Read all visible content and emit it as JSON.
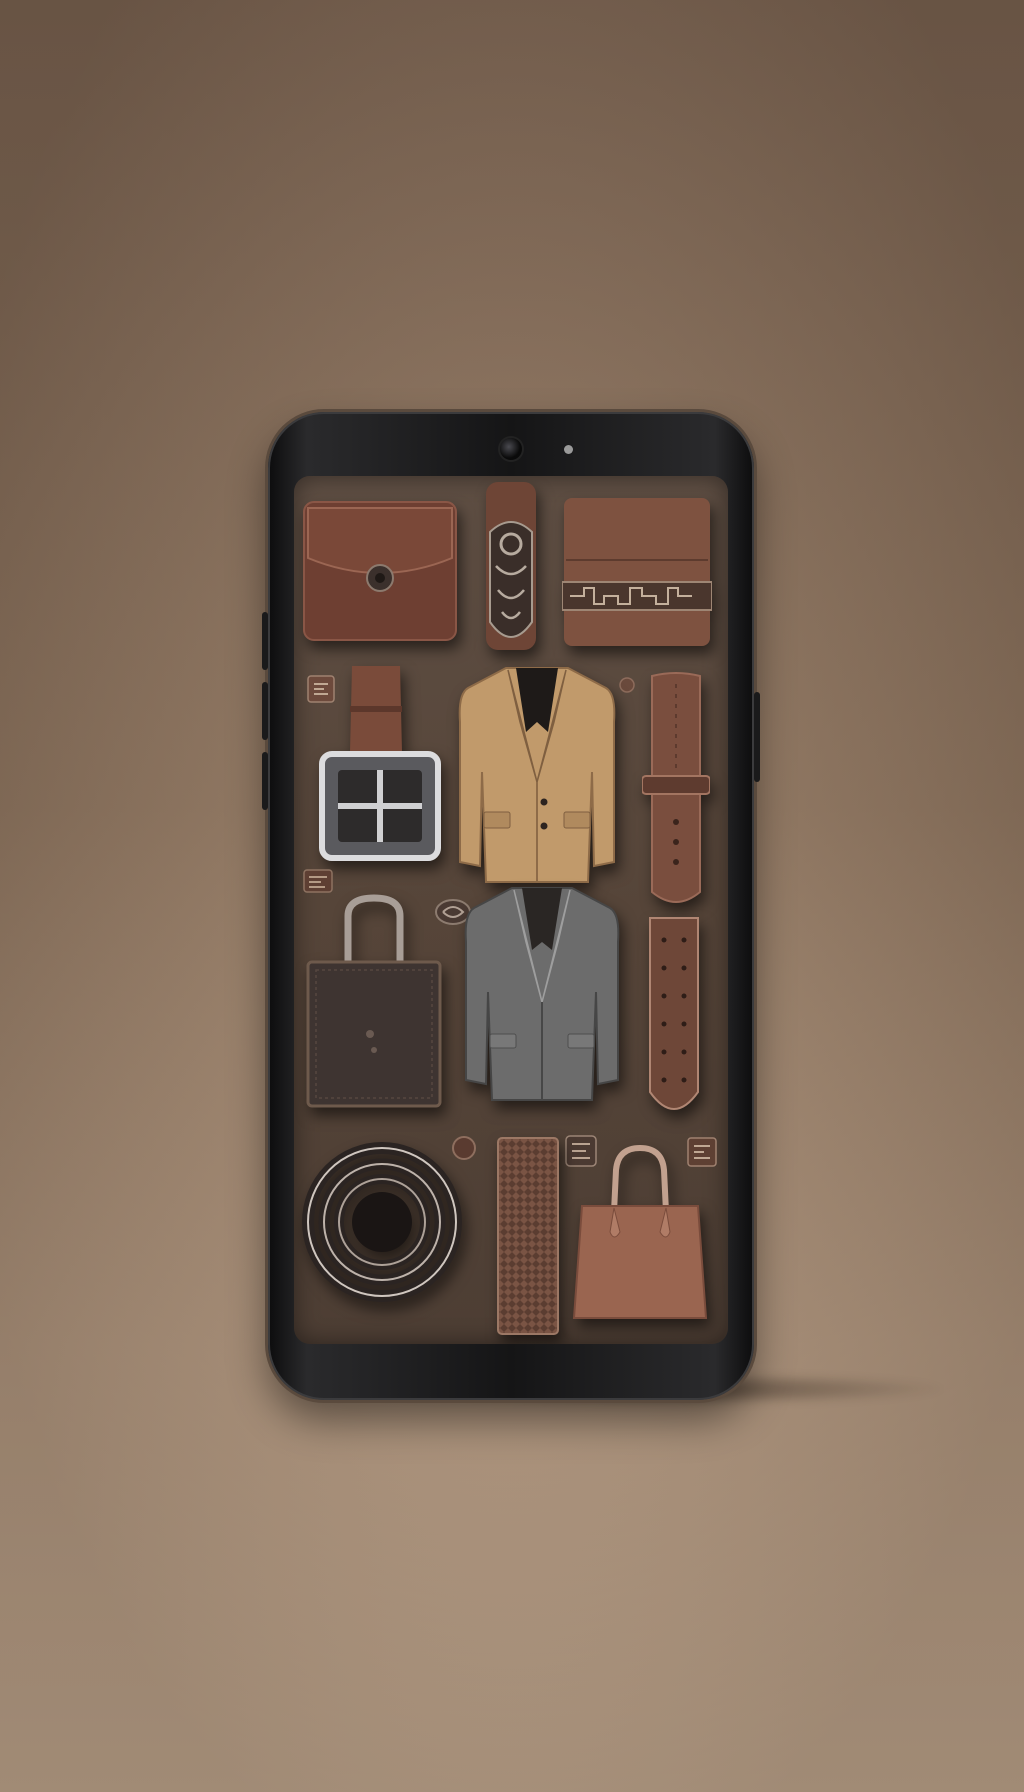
{
  "scene": {
    "background_color": "#957a63",
    "phone_frame_color": "#151516",
    "screen_color": "#564539"
  },
  "items": [
    {
      "id": "wallet",
      "icon": "leather-wallet-icon"
    },
    {
      "id": "ornate-strap",
      "icon": "ornate-strap-icon"
    },
    {
      "id": "embossed-pouch",
      "icon": "embossed-pouch-icon"
    },
    {
      "id": "belt-buckle",
      "icon": "belt-buckle-icon"
    },
    {
      "id": "tan-blazer",
      "icon": "tan-blazer-icon"
    },
    {
      "id": "brown-strap",
      "icon": "watch-strap-icon"
    },
    {
      "id": "dark-handbag",
      "icon": "handbag-icon"
    },
    {
      "id": "grey-blazer",
      "icon": "grey-blazer-icon"
    },
    {
      "id": "perforated-strap",
      "icon": "perforated-strap-icon"
    },
    {
      "id": "coiled-belt",
      "icon": "coiled-belt-icon"
    },
    {
      "id": "woven-tie",
      "icon": "woven-tie-icon"
    },
    {
      "id": "tote-bag",
      "icon": "tote-bag-icon"
    }
  ]
}
